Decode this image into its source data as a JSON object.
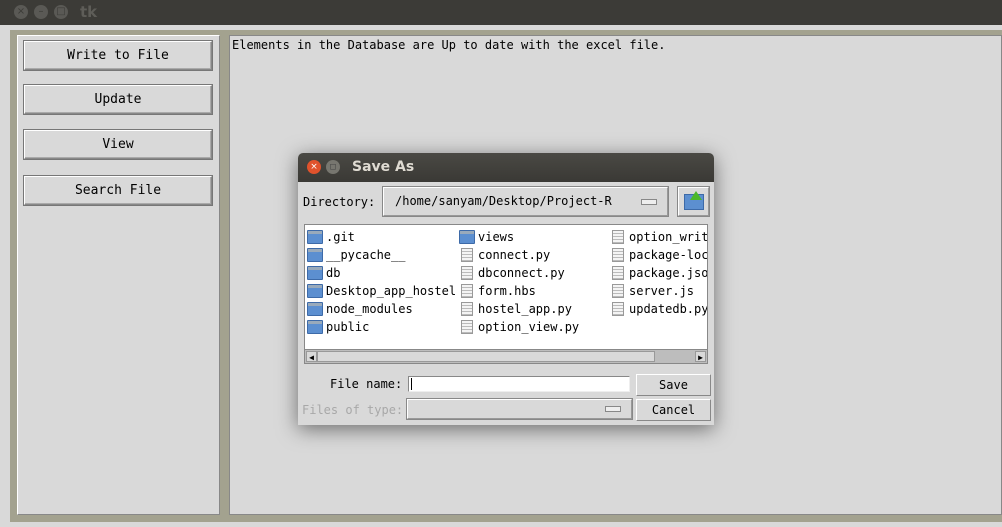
{
  "window": {
    "title": "tk"
  },
  "sidebar": {
    "buttons": [
      "Write to File",
      "Update",
      "View",
      "Search File"
    ]
  },
  "main": {
    "message": "Elements in the Database are Up to date with the excel file."
  },
  "dialog": {
    "title": "Save As",
    "directory_label": "Directory:",
    "directory_value": "/home/sanyam/Desktop/Project-R",
    "columns": [
      [
        {
          "name": ".git",
          "type": "folder"
        },
        {
          "name": "__pycache__",
          "type": "folder"
        },
        {
          "name": "db",
          "type": "folder"
        },
        {
          "name": "Desktop_app_hostel",
          "type": "folder"
        },
        {
          "name": "node_modules",
          "type": "folder"
        },
        {
          "name": "public",
          "type": "folder"
        }
      ],
      [
        {
          "name": "views",
          "type": "folder"
        },
        {
          "name": "connect.py",
          "type": "file"
        },
        {
          "name": "dbconnect.py",
          "type": "file"
        },
        {
          "name": "form.hbs",
          "type": "file"
        },
        {
          "name": "hostel_app.py",
          "type": "file"
        },
        {
          "name": "option_view.py",
          "type": "file"
        }
      ],
      [
        {
          "name": "option_writ",
          "type": "file"
        },
        {
          "name": "package-loc",
          "type": "file"
        },
        {
          "name": "package.jso",
          "type": "file"
        },
        {
          "name": "server.js",
          "type": "file"
        },
        {
          "name": "updatedb.py",
          "type": "file"
        }
      ]
    ],
    "file_name_label": "File name:",
    "file_name_value": "",
    "files_of_type_label": "Files of type:",
    "files_of_type_value": "",
    "save_label": "Save",
    "cancel_label": "Cancel"
  },
  "colors": {
    "titlebar": "#3c3b37",
    "close_button": "#e0522c",
    "frame": "#a3a28f",
    "background": "#d9d9d9"
  }
}
